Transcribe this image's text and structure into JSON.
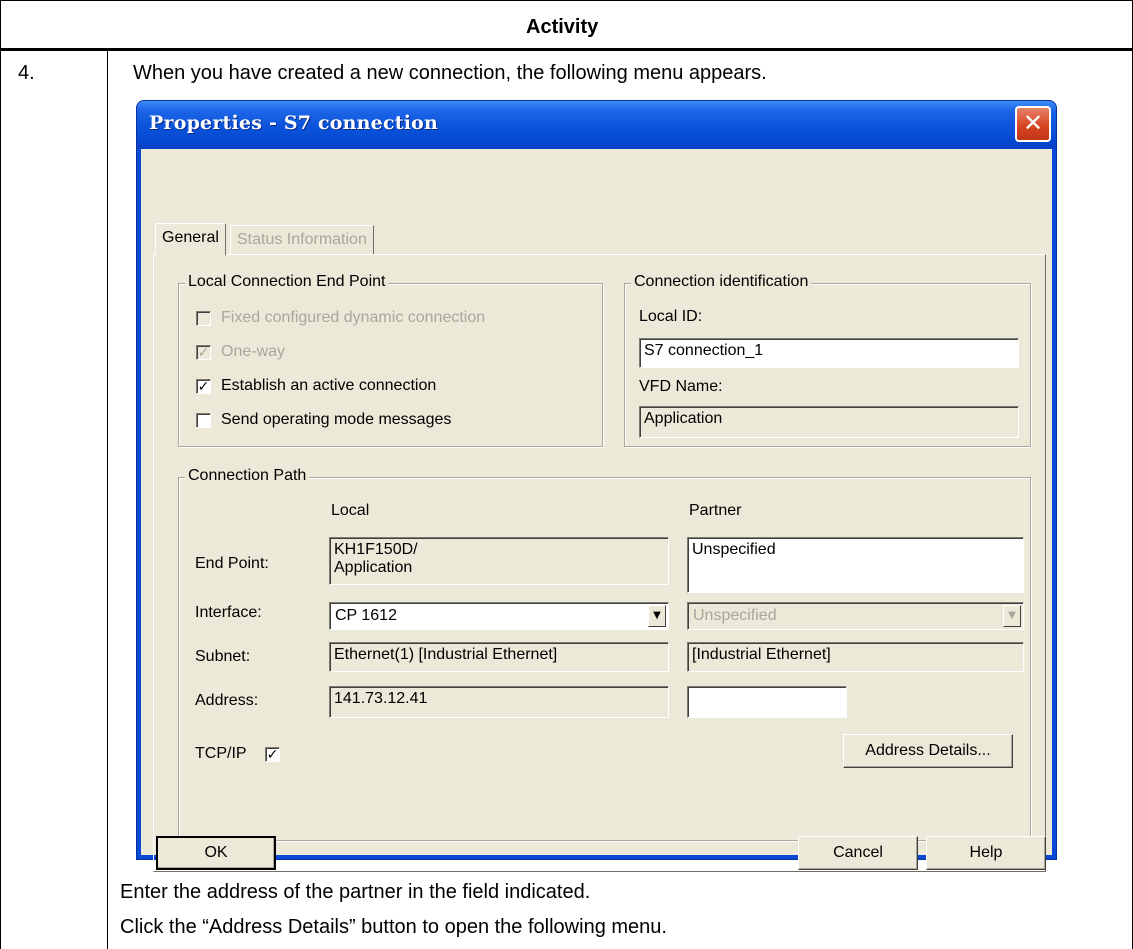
{
  "doc": {
    "header": "Activity",
    "step_number": "4.",
    "intro_text": "When you have created a new connection, the following menu appears.",
    "instruction_1": "Enter the address of the partner in the field indicated.",
    "instruction_2": "Click the “Address Details” button to open the following menu."
  },
  "dialog": {
    "title": "Properties - S7 connection",
    "close_glyph": "✕",
    "tabs": [
      {
        "label": "General",
        "state": "active"
      },
      {
        "label": "Status Information",
        "state": "disabled"
      }
    ],
    "local_end_point": {
      "group_label": "Local Connection End Point",
      "options": [
        {
          "label": "Fixed configured dynamic connection",
          "checked": false,
          "enabled": false
        },
        {
          "label": "One-way",
          "checked": true,
          "enabled": false
        },
        {
          "label": "Establish an active connection",
          "checked": true,
          "enabled": true
        },
        {
          "label": "Send operating mode messages",
          "checked": false,
          "enabled": true
        }
      ]
    },
    "connection_identification": {
      "group_label": "Connection identification",
      "local_id_label": "Local ID:",
      "local_id_value": "S7 connection_1",
      "vfd_name_label": "VFD Name:",
      "vfd_name_value": "Application"
    },
    "connection_path": {
      "group_label": "Connection Path",
      "local_header": "Local",
      "partner_header": "Partner",
      "end_point_label": "End Point:",
      "end_point_local": "KH1F150D/\nApplication",
      "end_point_partner": "Unspecified",
      "interface_label": "Interface:",
      "interface_local": "CP 1612",
      "interface_partner": "Unspecified",
      "subnet_label": "Subnet:",
      "subnet_local": "Ethernet(1) [Industrial Ethernet]",
      "subnet_partner": "[Industrial Ethernet]",
      "address_label": "Address:",
      "address_local": "141.73.12.41",
      "address_partner": "",
      "tcpip_label": "TCP/IP",
      "tcpip_checked": true,
      "address_details_button": "Address Details..."
    },
    "buttons": {
      "ok": "OK",
      "cancel": "Cancel",
      "help": "Help"
    }
  }
}
